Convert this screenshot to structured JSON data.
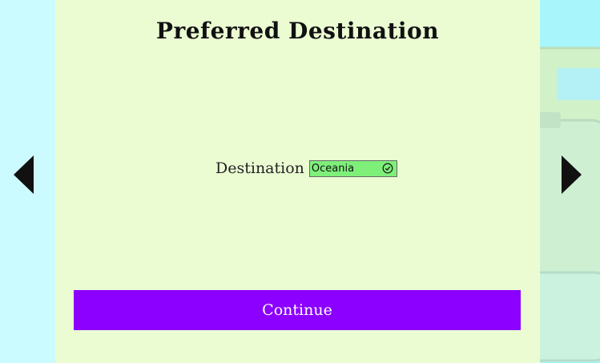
{
  "page": {
    "title": "Preferred Destination"
  },
  "form": {
    "destination_label": "Destination",
    "destination_value": "Oceania",
    "destination_status_icon": "check-circle-icon"
  },
  "actions": {
    "continue_label": "Continue"
  },
  "navigation": {
    "prev_icon": "triangle-left-icon",
    "next_icon": "triangle-right-icon"
  },
  "colors": {
    "panel_background": "#ebfcd3",
    "side_background": "#ccfbff",
    "button_background": "#8b00ff",
    "select_background": "#7ef07a"
  }
}
